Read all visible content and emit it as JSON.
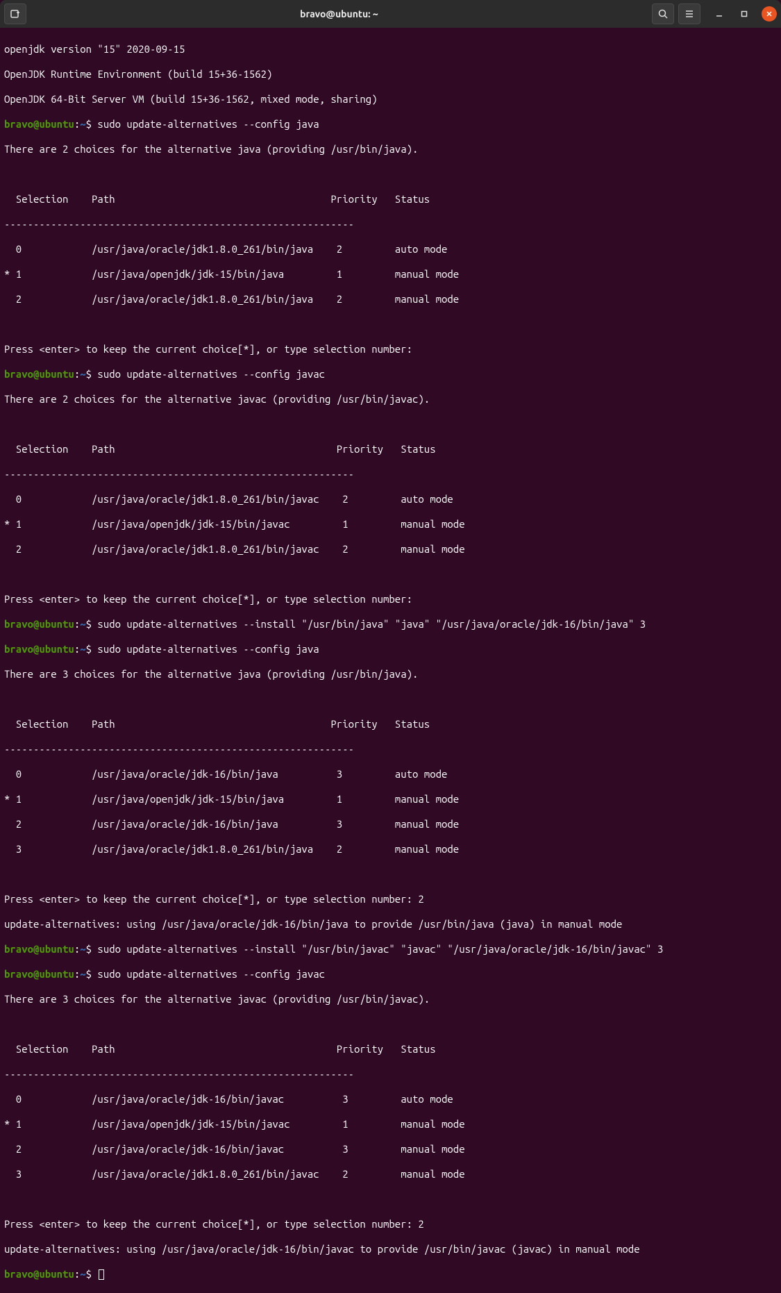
{
  "titlebar": {
    "title": "bravo@ubuntu: ~",
    "icons": {
      "newtab": "new-tab-icon",
      "search": "search-icon",
      "menu": "hamburger-icon",
      "minimize": "minimize-icon",
      "maximize": "maximize-icon",
      "close": "close-icon"
    }
  },
  "colors": {
    "bg": "#300a24",
    "user": "#4e9a06",
    "path": "#3465a4",
    "text": "#ffffff",
    "titlebar": "#2c2c2c",
    "close": "#e95420"
  },
  "prompt": {
    "user_host": "bravo@ubuntu",
    "path": "~",
    "symbol": "$"
  },
  "output": {
    "l1": "openjdk version \"15\" 2020-09-15",
    "l2": "OpenJDK Runtime Environment (build 15+36-1562)",
    "l3": "OpenJDK 64-Bit Server VM (build 15+36-1562, mixed mode, sharing)",
    "cmd1": " sudo update-alternatives --config java",
    "l4": "There are 2 choices for the alternative java (providing /usr/bin/java).",
    "blank": " ",
    "hdr": "  Selection    Path                                     Priority   Status",
    "sep": "------------------------------------------------------------",
    "t1r0": "  0            /usr/java/oracle/jdk1.8.0_261/bin/java    2         auto mode",
    "t1r1": "* 1            /usr/java/openjdk/jdk-15/bin/java         1         manual mode",
    "t1r2": "  2            /usr/java/oracle/jdk1.8.0_261/bin/java    2         manual mode",
    "press1": "Press <enter> to keep the current choice[*], or type selection number: ",
    "cmd2": " sudo update-alternatives --config javac",
    "l5": "There are 2 choices for the alternative javac (providing /usr/bin/javac).",
    "hdr2": "  Selection    Path                                      Priority   Status",
    "t2r0": "  0            /usr/java/oracle/jdk1.8.0_261/bin/javac    2         auto mode",
    "t2r1": "* 1            /usr/java/openjdk/jdk-15/bin/javac         1         manual mode",
    "t2r2": "  2            /usr/java/oracle/jdk1.8.0_261/bin/javac    2         manual mode",
    "cmd3": " sudo update-alternatives --install \"/usr/bin/java\" \"java\" \"/usr/java/oracle/jdk-16/bin/java\" 3",
    "cmd4": " sudo update-alternatives --config java",
    "l6": "There are 3 choices for the alternative java (providing /usr/bin/java).",
    "t3r0": "  0            /usr/java/oracle/jdk-16/bin/java          3         auto mode",
    "t3r1": "* 1            /usr/java/openjdk/jdk-15/bin/java         1         manual mode",
    "t3r2": "  2            /usr/java/oracle/jdk-16/bin/java          3         manual mode",
    "t3r3": "  3            /usr/java/oracle/jdk1.8.0_261/bin/java    2         manual mode",
    "press2": "Press <enter> to keep the current choice[*], or type selection number: 2",
    "upd1": "update-alternatives: using /usr/java/oracle/jdk-16/bin/java to provide /usr/bin/java (java) in manual mode",
    "cmd5": " sudo update-alternatives --install \"/usr/bin/javac\" \"javac\" \"/usr/java/oracle/jdk-16/bin/javac\" 3",
    "cmd6": " sudo update-alternatives --config javac",
    "l7": "There are 3 choices for the alternative javac (providing /usr/bin/javac).",
    "t4r0": "  0            /usr/java/oracle/jdk-16/bin/javac          3         auto mode",
    "t4r1": "* 1            /usr/java/openjdk/jdk-15/bin/javac         1         manual mode",
    "t4r2": "  2            /usr/java/oracle/jdk-16/bin/javac          3         manual mode",
    "t4r3": "  3            /usr/java/oracle/jdk1.8.0_261/bin/javac    2         manual mode",
    "press3": "Press <enter> to keep the current choice[*], or type selection number: 2",
    "upd2": "update-alternatives: using /usr/java/oracle/jdk-16/bin/javac to provide /usr/bin/javac (javac) in manual mode",
    "cmd7": " "
  }
}
